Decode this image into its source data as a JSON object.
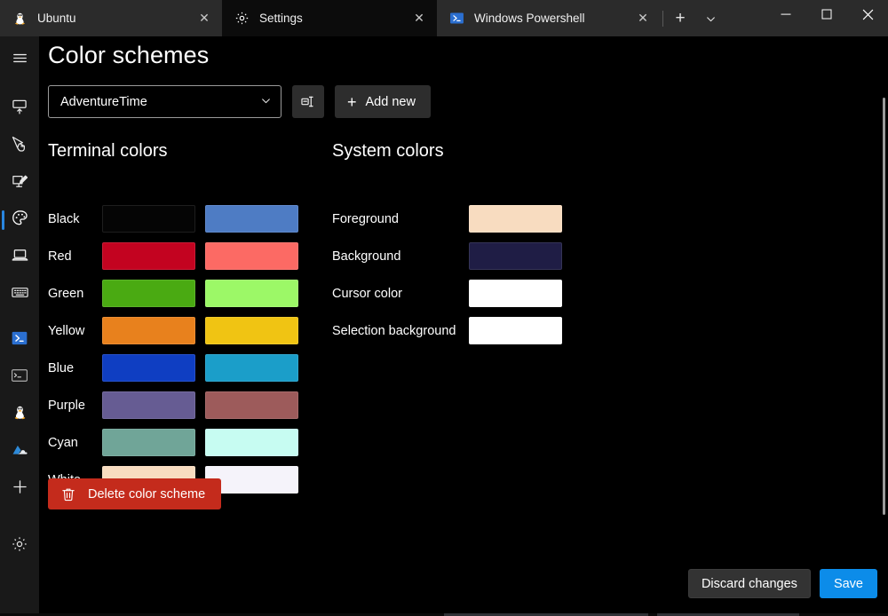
{
  "window": {
    "tabs": [
      {
        "title": "Ubuntu",
        "icon": "ubuntu-tux-icon",
        "active": false,
        "close_label": "✕"
      },
      {
        "title": "Settings",
        "icon": "gear-icon",
        "active": true,
        "close_label": "✕"
      },
      {
        "title": "Windows Powershell",
        "icon": "powershell-icon",
        "active": false,
        "close_label": "✕"
      }
    ],
    "new_tab_label": "+",
    "tab_dropdown_label": "⌄",
    "controls": {
      "minimize": "─",
      "maximize": "☐",
      "close": "✕"
    }
  },
  "sidebar": {
    "items": [
      {
        "name": "hamburger-menu",
        "icon": "hamburger-icon",
        "selected": false
      },
      {
        "name": "startup",
        "icon": "startup-icon",
        "selected": false
      },
      {
        "name": "interaction",
        "icon": "cursor-hand-icon",
        "selected": false
      },
      {
        "name": "appearance",
        "icon": "monitor-pen-icon",
        "selected": false
      },
      {
        "name": "color-schemes",
        "icon": "palette-icon",
        "selected": true
      },
      {
        "name": "rendering",
        "icon": "laptop-icon",
        "selected": false
      },
      {
        "name": "actions",
        "icon": "keyboard-icon",
        "selected": false
      },
      {
        "name": "profile-powershell",
        "icon": "powershell-icon",
        "selected": false
      },
      {
        "name": "profile-command-prompt",
        "icon": "command-prompt-icon",
        "selected": false
      },
      {
        "name": "profile-ubuntu",
        "icon": "ubuntu-tux-icon",
        "selected": false
      },
      {
        "name": "profile-azure-cloud-shell",
        "icon": "azure-cloud-icon",
        "selected": false
      },
      {
        "name": "add-new-profile",
        "icon": "plus-icon",
        "selected": false
      },
      {
        "name": "open-json-file",
        "icon": "gear-icon",
        "selected": false
      }
    ]
  },
  "page": {
    "title": "Color schemes",
    "scheme_selector": {
      "value": "AdventureTime",
      "arrow": "⌄"
    },
    "rename_button_label": "rename-scheme",
    "add_new_button": {
      "plus": "+",
      "label": "Add new"
    },
    "delete_button": {
      "label": "Delete color scheme"
    },
    "footer": {
      "discard_label": "Discard changes",
      "save_label": "Save"
    }
  },
  "terminal_colors": {
    "title": "Terminal colors",
    "rows": [
      {
        "label": "Black",
        "normal": "#050505",
        "bright": "#4e7cc4"
      },
      {
        "label": "Red",
        "normal": "#c30320",
        "bright": "#fc6a64"
      },
      {
        "label": "Green",
        "normal": "#4aaa12",
        "bright": "#9cf867"
      },
      {
        "label": "Yellow",
        "normal": "#e8811d",
        "bright": "#f0c413"
      },
      {
        "label": "Blue",
        "normal": "#0f3ec2",
        "bright": "#1b9ec9"
      },
      {
        "label": "Purple",
        "normal": "#665c93",
        "bright": "#9d5b5b"
      },
      {
        "label": "Cyan",
        "normal": "#70a598",
        "bright": "#c7fcf2"
      },
      {
        "label": "White",
        "normal": "#f8dcc0",
        "bright": "#f5f3fa"
      }
    ]
  },
  "system_colors": {
    "title": "System colors",
    "rows": [
      {
        "label": "Foreground",
        "color": "#f8dcc0"
      },
      {
        "label": "Background",
        "color": "#1f1d45"
      },
      {
        "label": "Cursor color",
        "color": "#ffffff"
      },
      {
        "label": "Selection background",
        "color": "#ffffff"
      }
    ]
  },
  "theme": {
    "accent": "#0c8ce9",
    "danger": "#c42b1c",
    "selected_indicator": "#2986e0"
  }
}
